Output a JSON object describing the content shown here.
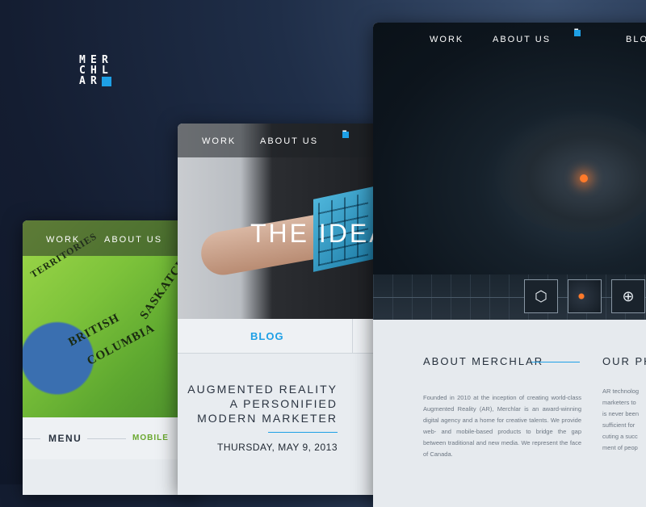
{
  "brand": {
    "logo_letters": [
      "M",
      "E",
      "R",
      "C",
      "H",
      "L",
      "A",
      "R"
    ],
    "accent": "#1ea0e6"
  },
  "mobile": {
    "nav": {
      "work": "WORK",
      "about": "ABOUT US"
    },
    "map_labels": [
      "TERRITORIES",
      "SASKATCHEWAN",
      "BRITISH",
      "COLUMBIA"
    ],
    "menu": "MENU",
    "mobile_tab": "MOBILE"
  },
  "tablet": {
    "nav": {
      "work": "WORK",
      "about": "ABOUT US"
    },
    "hero_title": "THE IDEA",
    "tab_blog": "BLOG",
    "article_lines": [
      "AUGMENTED REALITY",
      "A PERSONIFIED",
      "MODERN MARKETER"
    ],
    "date": "THURSDAY, MAY 9, 2013"
  },
  "desktop": {
    "nav": {
      "work": "WORK",
      "about": "ABOUT US",
      "blog": "BLOG"
    },
    "thumbnails": [
      "hexagon-logo-icon",
      "creature-thumbnail",
      "target-icon"
    ],
    "about_heading": "ABOUT MERCHLAR",
    "about_text": "Founded in 2010 at the inception of creating world-class Augmented Reality (AR), Merchlar is an award-winning digital agency and a home for creative talents. We provide web- and mobile-based products to bridge the gap between traditional and new media. We represent the face of Canada.",
    "our_heading": "OUR PH",
    "our_text": "AR technolog\nmarketers to \nis never been\nsufficient for\ncuting a succ\nment of peop"
  }
}
